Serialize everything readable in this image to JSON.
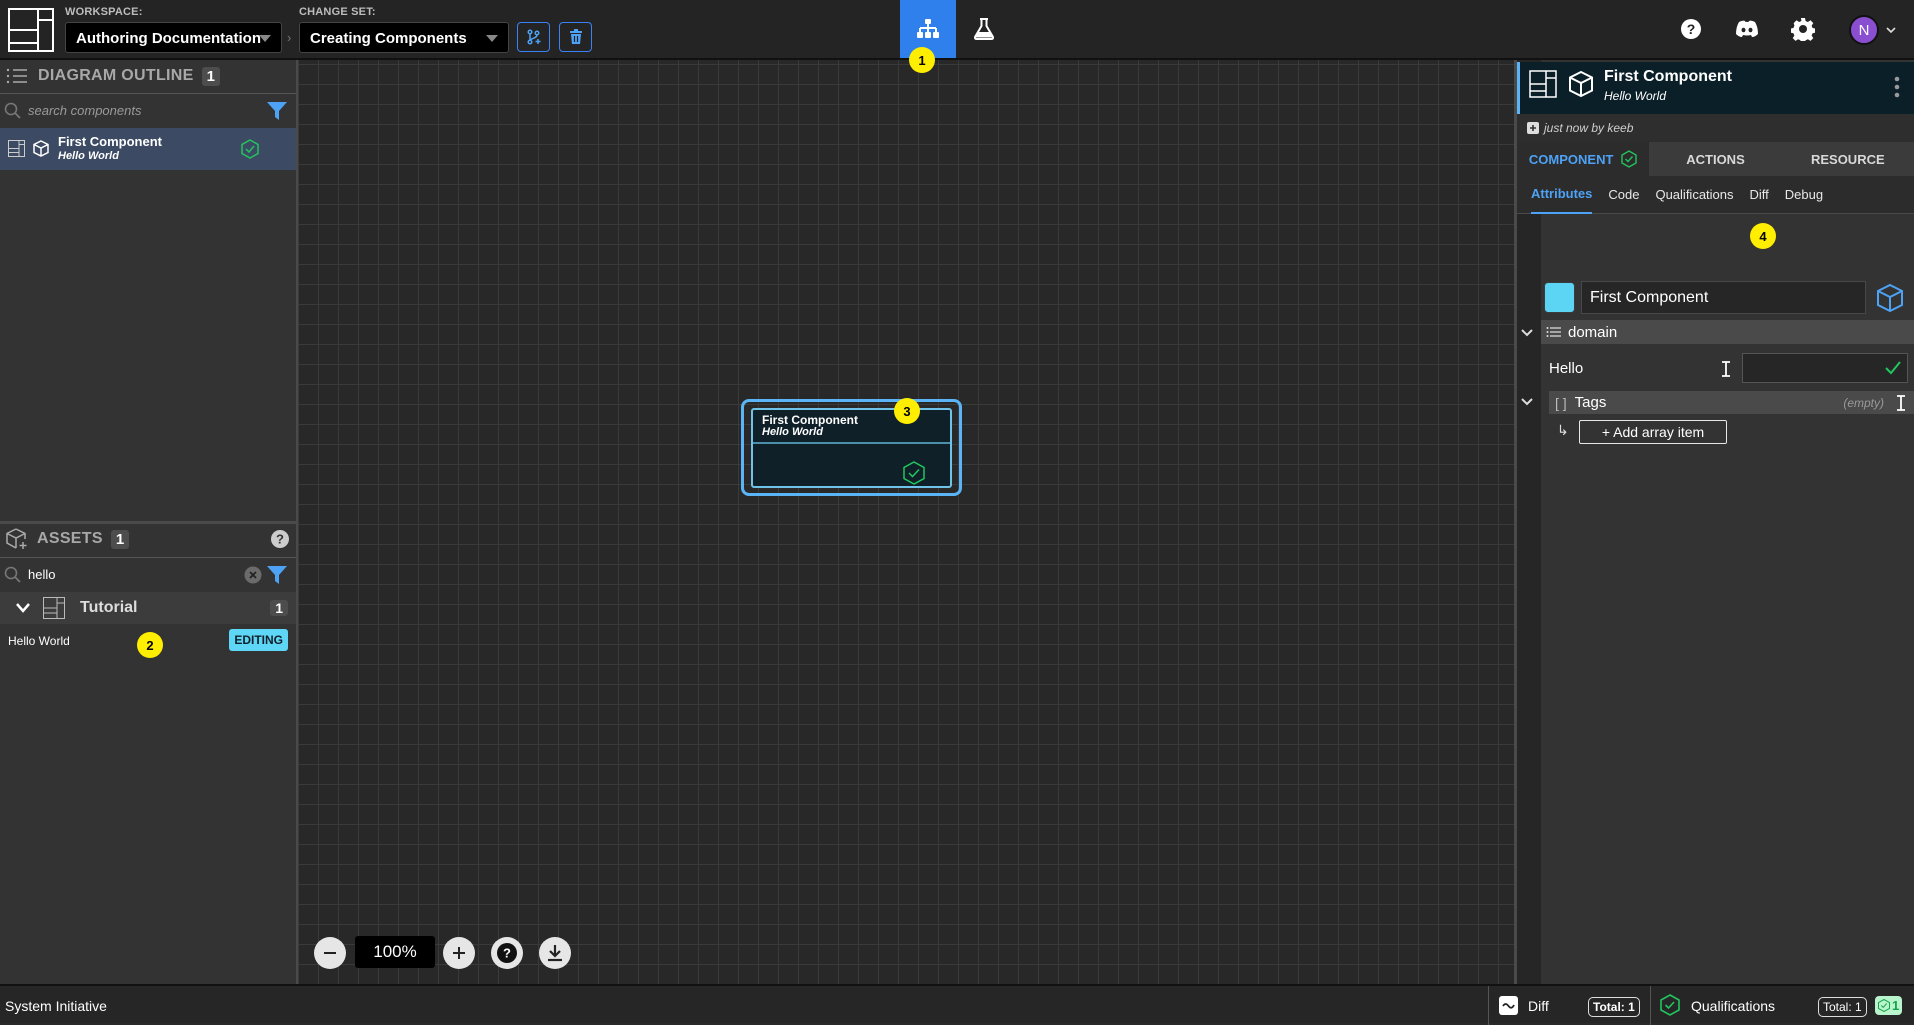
{
  "topbar": {
    "workspace_label": "WORKSPACE:",
    "workspace_value": "Authoring Documentation",
    "changeset_label": "CHANGE SET:",
    "changeset_value": "Creating Components",
    "separator": "›",
    "center_tabs": [
      {
        "icon": "diagram-icon",
        "active": true
      },
      {
        "icon": "flask-icon",
        "active": false
      }
    ],
    "right_icons": [
      "help-icon",
      "discord-icon",
      "gear-icon"
    ],
    "user_initial": "N",
    "accent": "#2f80ed"
  },
  "markers": [
    "1",
    "2",
    "3",
    "4"
  ],
  "outline": {
    "title": "DIAGRAM OUTLINE",
    "count": "1",
    "search_placeholder": "search components",
    "items": [
      {
        "title": "First Component",
        "subtitle": "Hello World",
        "status": "qualified"
      }
    ]
  },
  "assets": {
    "title": "ASSETS",
    "count": "1",
    "search_value": "hello",
    "categories": [
      {
        "name": "Tutorial",
        "count": "1",
        "items": [
          {
            "name": "Hello World",
            "badge": "EDITING"
          }
        ]
      }
    ]
  },
  "canvas": {
    "node": {
      "title": "First Component",
      "subtitle": "Hello World"
    },
    "zoom_level": "100%"
  },
  "details": {
    "title": "First Component",
    "subtitle": "Hello World",
    "history": "just now by keeb",
    "tabs": [
      "COMPONENT",
      "ACTIONS",
      "RESOURCE"
    ],
    "active_tab": "COMPONENT",
    "subtabs": [
      "Attributes",
      "Code",
      "Qualifications",
      "Diff",
      "Debug"
    ],
    "active_subtab": "Attributes",
    "component_color": "#5cd5f5",
    "name_value": "First Component",
    "section": "domain",
    "props": [
      {
        "label": "Hello",
        "value": ""
      }
    ],
    "tags_label": "Tags",
    "tags_empty": "(empty)",
    "tags_bracket": "[ ]",
    "add_array_item": "+ Add array item",
    "arrow": "↳"
  },
  "statusbar": {
    "app_name": "System Initiative",
    "diff_label": "Diff",
    "diff_total": "Total: 1",
    "qual_label": "Qualifications",
    "qual_total": "Total: 1",
    "qual_ok": "1"
  }
}
